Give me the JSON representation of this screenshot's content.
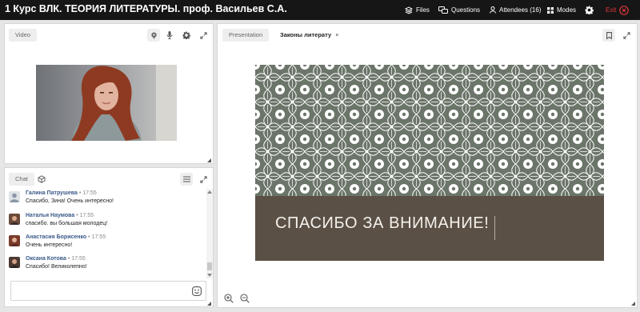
{
  "header": {
    "title": "1 Курс ВЛК. ТЕОРИЯ ЛИТЕРАТУРЫ. проф. Васильев С.А.",
    "files": "Files",
    "questions": "Questions",
    "attendees": "Attendees (16)",
    "modes": "Modes",
    "exit": "Exit"
  },
  "video_panel": {
    "tab": "Video"
  },
  "chat_panel": {
    "tab": "Chat",
    "messages": [
      {
        "name": "Галина Патрушева",
        "time": "• 17:55",
        "text": "Спасибо, Зина! Очень интересно!"
      },
      {
        "name": "Наталья Наумова",
        "time": "• 17:55",
        "text": "спасибо. вы большая молодец!"
      },
      {
        "name": "Анастасия Борисенко",
        "time": "• 17:55",
        "text": "Очень интересно!"
      },
      {
        "name": "Оксана Котова",
        "time": "• 17:55",
        "text": "Спасибо! Великолепно!"
      }
    ],
    "input_value": ""
  },
  "presentation_panel": {
    "tabs": [
      "Presentation",
      "Законы литерату"
    ],
    "slide_text": "СПАСИБО ЗА ВНИМАНИЕ!"
  },
  "colors": {
    "topbar": "#161616",
    "exit": "#e2373a",
    "slide_pattern_bg": "#6b7569",
    "slide_band": "#5a5046",
    "chat_name": "#3a5a8a"
  },
  "icons": [
    "files-icon",
    "questions-icon",
    "attendees-icon",
    "modes-icon",
    "settings-icon",
    "exit-icon",
    "pin-icon",
    "mic-icon",
    "gear-icon",
    "expand-icon",
    "cube-icon",
    "menu-icon",
    "bookmark-icon",
    "zoom-in-icon",
    "zoom-out-icon",
    "emoji-icon"
  ]
}
